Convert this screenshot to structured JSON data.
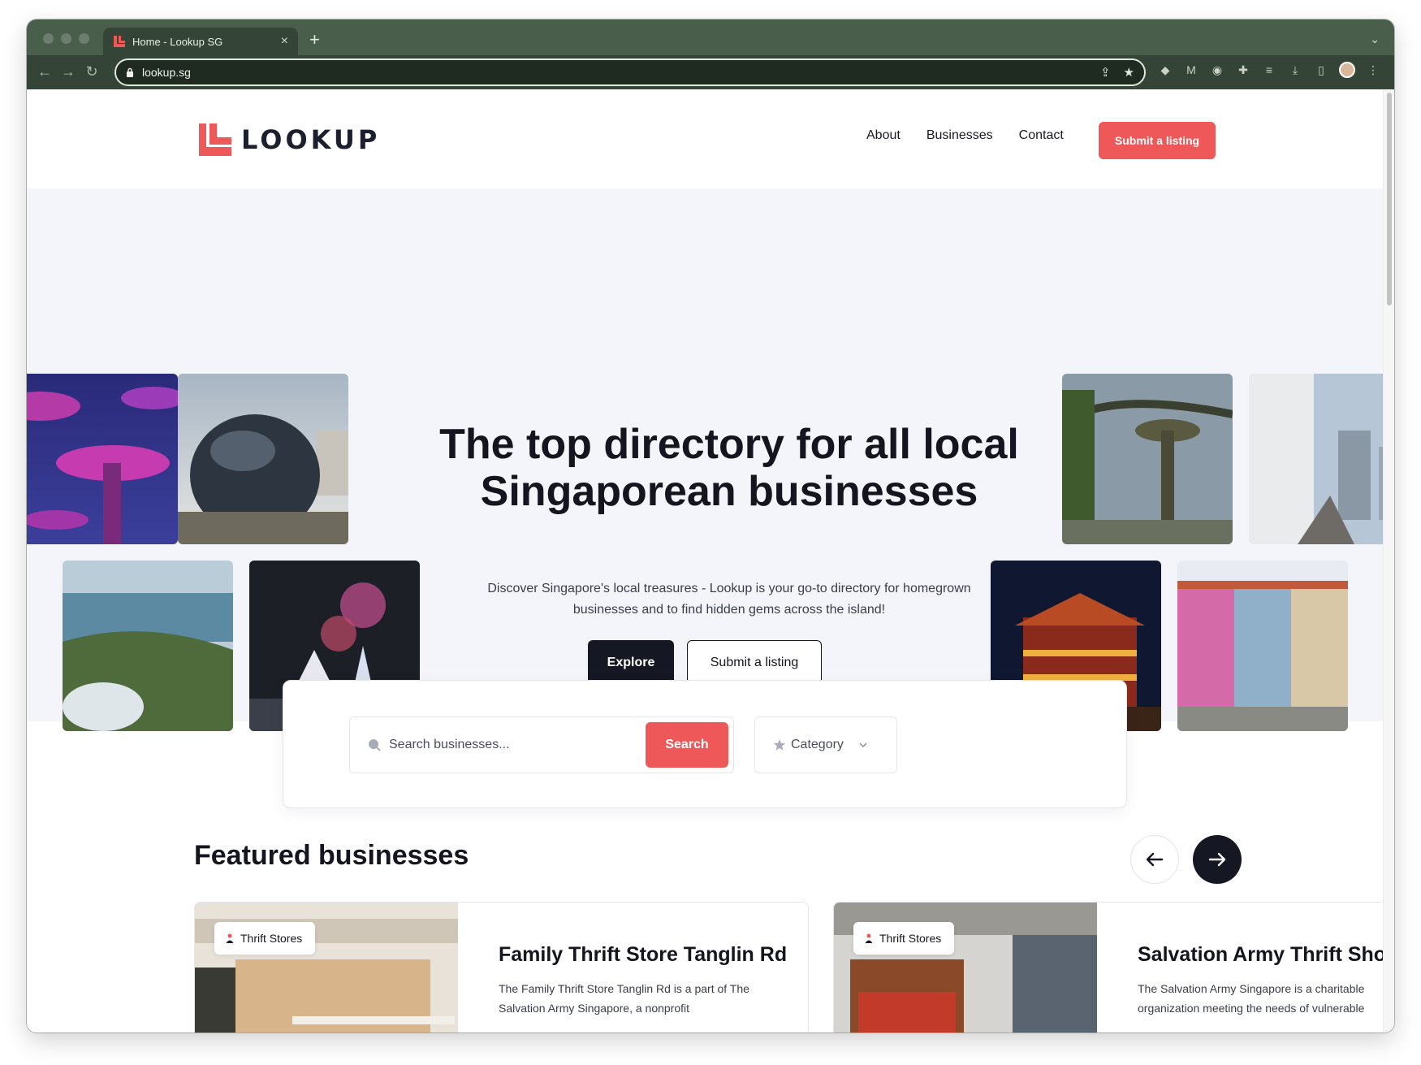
{
  "browser": {
    "tab_title": "Home - Lookup SG",
    "tab_close": "×",
    "new_tab": "+",
    "url": "lookup.sg"
  },
  "site": {
    "logo_text": "LOOKUP",
    "nav": [
      "About",
      "Businesses",
      "Contact"
    ],
    "submit_listing_top": "Submit a listing",
    "brand_color": "#ef5858",
    "dark_color": "#151722"
  },
  "hero": {
    "title": "The top directory for all local Singaporean businesses",
    "subtitle": "Discover Singapore's local treasures - Lookup is your go-to directory for homegrown businesses and to find hidden gems across the island!",
    "explore_label": "Explore",
    "submit_label": "Submit a listing"
  },
  "search": {
    "placeholder": "Search businesses...",
    "button_label": "Search",
    "category_label": "Category"
  },
  "featured": {
    "title": "Featured businesses",
    "cards": [
      {
        "tag": "Thrift Stores",
        "name": "Family Thrift Store Tanglin Rd",
        "description": "The Family Thrift Store Tanglin Rd is a part of The Salvation Army Singapore, a nonprofit"
      },
      {
        "tag": "Thrift Stores",
        "name": "Salvation Army Thrift Shop",
        "description": "The Salvation Army Singapore is a charitable organization meeting the needs of vulnerable"
      }
    ]
  }
}
